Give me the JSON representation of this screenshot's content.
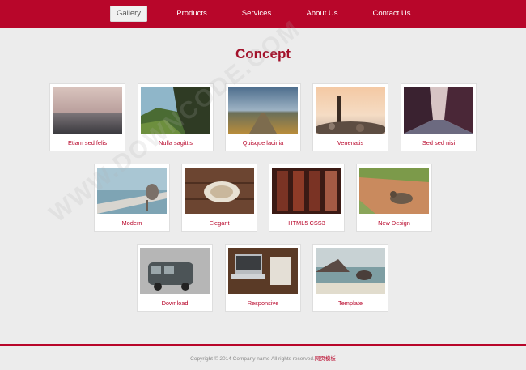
{
  "nav": {
    "items": [
      {
        "label": "Gallery",
        "active": true
      },
      {
        "label": "Products",
        "active": false
      },
      {
        "label": "Services",
        "active": false
      },
      {
        "label": "About Us",
        "active": false
      },
      {
        "label": "Contact Us",
        "active": false
      }
    ]
  },
  "main": {
    "title": "Concept",
    "gallery": [
      {
        "caption": "Etiam sed felis",
        "image": "misty-seascape"
      },
      {
        "caption": "Nulla sagittis",
        "image": "green-hillside"
      },
      {
        "caption": "Quisque lacinia",
        "image": "road-sunset"
      },
      {
        "caption": "Venenatis",
        "image": "rocky-shore-post"
      },
      {
        "caption": "Sed sed nisi",
        "image": "canal-town"
      },
      {
        "caption": "Modern",
        "image": "pelican-pier"
      },
      {
        "caption": "Elegant",
        "image": "coffee-cup-table"
      },
      {
        "caption": "HTML5 CSS3",
        "image": "wine-cellar"
      },
      {
        "caption": "New Design",
        "image": "leopard-dirt-road"
      },
      {
        "caption": "Download",
        "image": "vintage-van"
      },
      {
        "caption": "Responsive",
        "image": "laptop-desk"
      },
      {
        "caption": "Template",
        "image": "ocean-rocks"
      }
    ]
  },
  "footer": {
    "copyright": "Copyright © 2014 Company name All rights reserved.",
    "link": "网页模板"
  },
  "watermark": "WWW.DOWNCODE.COM",
  "colors": {
    "brand": "#b8062a",
    "title": "#a3122b",
    "background": "#ececec"
  }
}
